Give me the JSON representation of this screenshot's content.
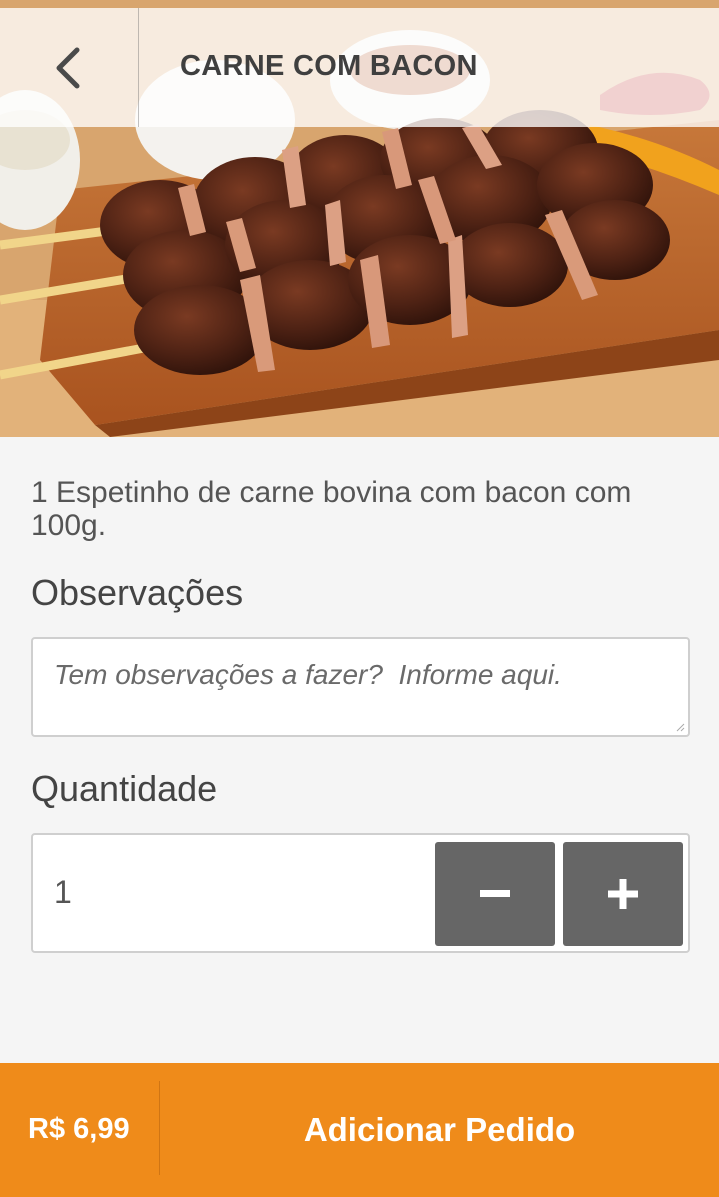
{
  "header": {
    "title": "CARNE COM BACON",
    "back_icon": "chevron-left-icon"
  },
  "hero": {
    "image": "beef-bacon-skewers-photo"
  },
  "product": {
    "description": "1 Espetinho de carne bovina com bacon com 100g."
  },
  "observations": {
    "label": "Observações",
    "placeholder": "Tem observações a fazer?  Informe aqui.",
    "value": ""
  },
  "quantity": {
    "label": "Quantidade",
    "value": "1",
    "decrement_label": "−",
    "increment_label": "+"
  },
  "footer": {
    "price": "R$ 6,99",
    "add_label": "Adicionar Pedido",
    "accent_color": "#ef8b1a"
  }
}
